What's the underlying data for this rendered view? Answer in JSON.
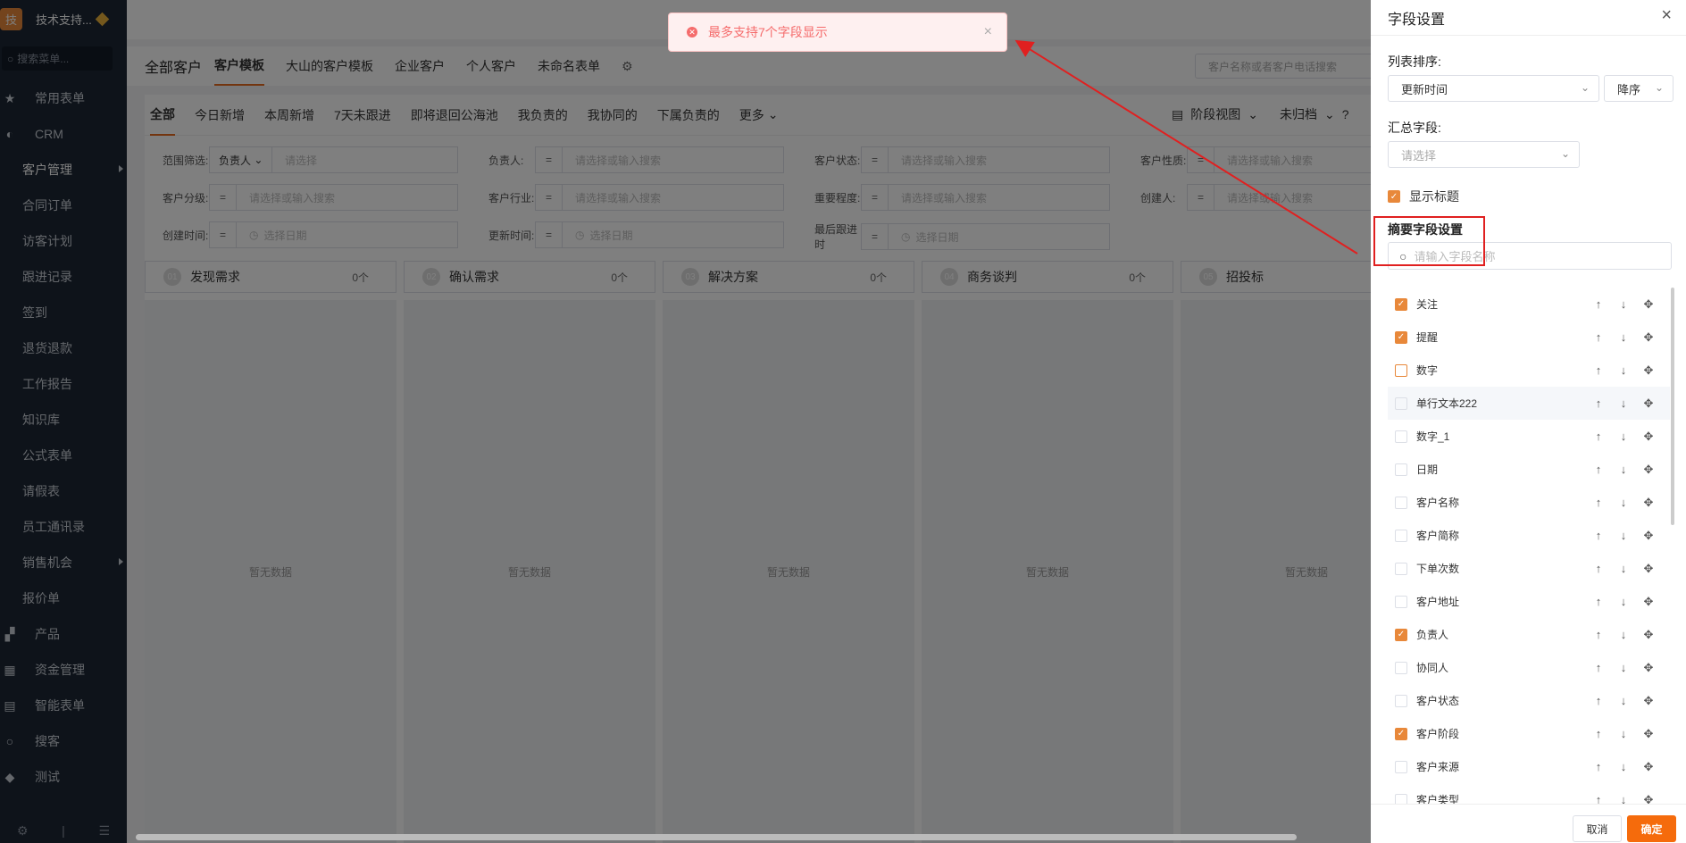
{
  "sidebar": {
    "logo_char": "技",
    "company": "技术支持...",
    "search_placeholder": "搜索菜单...",
    "items": [
      {
        "label": "常用表单",
        "icon": "star-icon"
      },
      {
        "label": "CRM",
        "icon": "crm-icon"
      },
      {
        "label": "客户管理",
        "sub": true,
        "active": true,
        "arrow": true
      },
      {
        "label": "合同订单",
        "sub": true
      },
      {
        "label": "访客计划",
        "sub": true
      },
      {
        "label": "跟进记录",
        "sub": true
      },
      {
        "label": "签到",
        "sub": true
      },
      {
        "label": "退货退款",
        "sub": true
      },
      {
        "label": "工作报告",
        "sub": true
      },
      {
        "label": "知识库",
        "sub": true
      },
      {
        "label": "公式表单",
        "sub": true
      },
      {
        "label": "请假表",
        "sub": true
      },
      {
        "label": "员工通讯录",
        "sub": true
      },
      {
        "label": "销售机会",
        "sub": true,
        "arrow": true
      },
      {
        "label": "报价单",
        "sub": true
      },
      {
        "label": "产品",
        "icon": "product-icon"
      },
      {
        "label": "资金管理",
        "icon": "finance-icon"
      },
      {
        "label": "智能表单",
        "icon": "form-icon"
      },
      {
        "label": "搜客",
        "icon": "search-icon"
      },
      {
        "label": "测试",
        "icon": "tag-icon"
      }
    ]
  },
  "header": {
    "page_title": "全部客户",
    "tabs": [
      "客户模板",
      "大山的客户模板",
      "企业客户",
      "个人客户",
      "未命名表单"
    ],
    "search_placeholder": "客户名称或者客户电话搜索"
  },
  "subtabs": [
    "全部",
    "今日新增",
    "本周新增",
    "7天未跟进",
    "即将退回公海池",
    "我负责的",
    "我协同的",
    "下属负责的",
    "更多"
  ],
  "view": {
    "stage_view": "阶段视图",
    "archive": "未归档"
  },
  "filters": {
    "row1": [
      {
        "label": "范围筛选:",
        "select": "负责人",
        "placeholder": "请选择"
      },
      {
        "label": "负责人:",
        "placeholder": "请选择或输入搜索"
      },
      {
        "label": "客户状态:",
        "placeholder": "请选择或输入搜索"
      },
      {
        "label": "客户性质:",
        "placeholder": "请选择或输入搜索"
      }
    ],
    "row2": [
      {
        "label": "客户分级:",
        "placeholder": "请选择或输入搜索"
      },
      {
        "label": "客户行业:",
        "placeholder": "请选择或输入搜索"
      },
      {
        "label": "重要程度:",
        "placeholder": "请选择或输入搜索"
      },
      {
        "label": "创建人:",
        "placeholder": "请选择或输入搜索"
      }
    ],
    "row3": [
      {
        "label": "创建时间:",
        "placeholder": "选择日期"
      },
      {
        "label": "更新时间:",
        "placeholder": "选择日期"
      },
      {
        "label": "最后跟进时",
        "placeholder": "选择日期"
      }
    ]
  },
  "stages": [
    {
      "num": "01",
      "name": "发现需求",
      "count": "0个",
      "empty": "暂无数据"
    },
    {
      "num": "02",
      "name": "确认需求",
      "count": "0个",
      "empty": "暂无数据"
    },
    {
      "num": "03",
      "name": "解决方案",
      "count": "0个",
      "empty": "暂无数据"
    },
    {
      "num": "04",
      "name": "商务谈判",
      "count": "0个",
      "empty": "暂无数据"
    },
    {
      "num": "05",
      "name": "招投标",
      "count": "",
      "empty": "暂无数据"
    }
  ],
  "toast": {
    "message": "最多支持7个字段显示"
  },
  "drawer": {
    "title": "字段设置",
    "sort_label": "列表排序:",
    "sort_field": "更新时间",
    "sort_order": "降序",
    "summary_label": "汇总字段:",
    "summary_placeholder": "请选择",
    "show_title": "显示标题",
    "abstract_title": "摘要字段设置",
    "field_search_placeholder": "请输入字段名称",
    "fields": [
      {
        "name": "关注",
        "checked": true
      },
      {
        "name": "提醒",
        "checked": true
      },
      {
        "name": "数字",
        "checked": false,
        "hover": true
      },
      {
        "name": "单行文本222",
        "checked": false,
        "highlight": true
      },
      {
        "name": "数字_1",
        "checked": false
      },
      {
        "name": "日期",
        "checked": false
      },
      {
        "name": "客户名称",
        "checked": false
      },
      {
        "name": "客户简称",
        "checked": false
      },
      {
        "name": "下单次数",
        "checked": false
      },
      {
        "name": "客户地址",
        "checked": false
      },
      {
        "name": "负责人",
        "checked": true
      },
      {
        "name": "协同人",
        "checked": false
      },
      {
        "name": "客户状态",
        "checked": false
      },
      {
        "name": "客户阶段",
        "checked": true
      },
      {
        "name": "客户来源",
        "checked": false
      },
      {
        "name": "客户类型",
        "checked": false
      }
    ],
    "cancel": "取消",
    "ok": "确定"
  },
  "colors": {
    "accent": "#e66a1f",
    "error": "#f56c6c",
    "sidebar_bg": "#1d2735",
    "annotation": "#e02020"
  }
}
